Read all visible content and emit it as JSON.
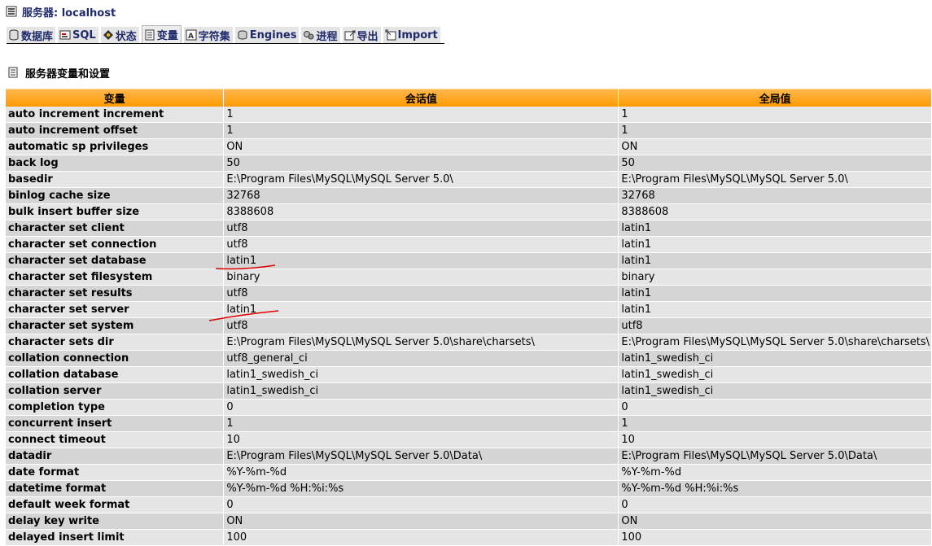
{
  "header": {
    "server_label": "服务器: localhost"
  },
  "tabs": [
    {
      "label": "数据库",
      "icon": "database-icon",
      "active": false
    },
    {
      "label": "SQL",
      "icon": "sql-icon",
      "active": false
    },
    {
      "label": "状态",
      "icon": "status-icon",
      "active": false
    },
    {
      "label": "变量",
      "icon": "variables-icon",
      "active": true
    },
    {
      "label": "字符集",
      "icon": "charset-icon",
      "active": false
    },
    {
      "label": "Engines",
      "icon": "engines-icon",
      "active": false
    },
    {
      "label": "进程",
      "icon": "processes-icon",
      "active": false
    },
    {
      "label": "导出",
      "icon": "export-icon",
      "active": false
    },
    {
      "label": "Import",
      "icon": "import-icon",
      "active": false
    }
  ],
  "section": {
    "title": "服务器变量和设置"
  },
  "table": {
    "columns": [
      "变量",
      "会话值",
      "全局值"
    ],
    "rows": [
      [
        "auto increment increment",
        "1",
        "1"
      ],
      [
        "auto increment offset",
        "1",
        "1"
      ],
      [
        "automatic sp privileges",
        "ON",
        "ON"
      ],
      [
        "back log",
        "50",
        "50"
      ],
      [
        "basedir",
        "E:\\Program Files\\MySQL\\MySQL Server 5.0\\",
        "E:\\Program Files\\MySQL\\MySQL Server 5.0\\"
      ],
      [
        "binlog cache size",
        "32768",
        "32768"
      ],
      [
        "bulk insert buffer size",
        "8388608",
        "8388608"
      ],
      [
        "character set client",
        "utf8",
        "latin1"
      ],
      [
        "character set connection",
        "utf8",
        "latin1"
      ],
      [
        "character set database",
        "latin1",
        "latin1"
      ],
      [
        "character set filesystem",
        "binary",
        "binary"
      ],
      [
        "character set results",
        "utf8",
        "latin1"
      ],
      [
        "character set server",
        "latin1",
        "latin1"
      ],
      [
        "character set system",
        "utf8",
        "utf8"
      ],
      [
        "character sets dir",
        "E:\\Program Files\\MySQL\\MySQL Server 5.0\\share\\charsets\\",
        "E:\\Program Files\\MySQL\\MySQL Server 5.0\\share\\charsets\\"
      ],
      [
        "collation connection",
        "utf8_general_ci",
        "latin1_swedish_ci"
      ],
      [
        "collation database",
        "latin1_swedish_ci",
        "latin1_swedish_ci"
      ],
      [
        "collation server",
        "latin1_swedish_ci",
        "latin1_swedish_ci"
      ],
      [
        "completion type",
        "0",
        "0"
      ],
      [
        "concurrent insert",
        "1",
        "1"
      ],
      [
        "connect timeout",
        "10",
        "10"
      ],
      [
        "datadir",
        "E:\\Program Files\\MySQL\\MySQL Server 5.0\\Data\\",
        "E:\\Program Files\\MySQL\\MySQL Server 5.0\\Data\\"
      ],
      [
        "date format",
        "%Y-%m-%d",
        "%Y-%m-%d"
      ],
      [
        "datetime format",
        "%Y-%m-%d %H:%i:%s",
        "%Y-%m-%d %H:%i:%s"
      ],
      [
        "default week format",
        "0",
        "0"
      ],
      [
        "delay key write",
        "ON",
        "ON"
      ],
      [
        "delayed insert limit",
        "100",
        "100"
      ]
    ]
  },
  "colors": {
    "header_orange": "#ff9a00",
    "row_light": "#e5e5e5",
    "row_dark": "#d5d5d5",
    "link_blue": "#1f2a6b",
    "annotation_red": "#e00000"
  }
}
